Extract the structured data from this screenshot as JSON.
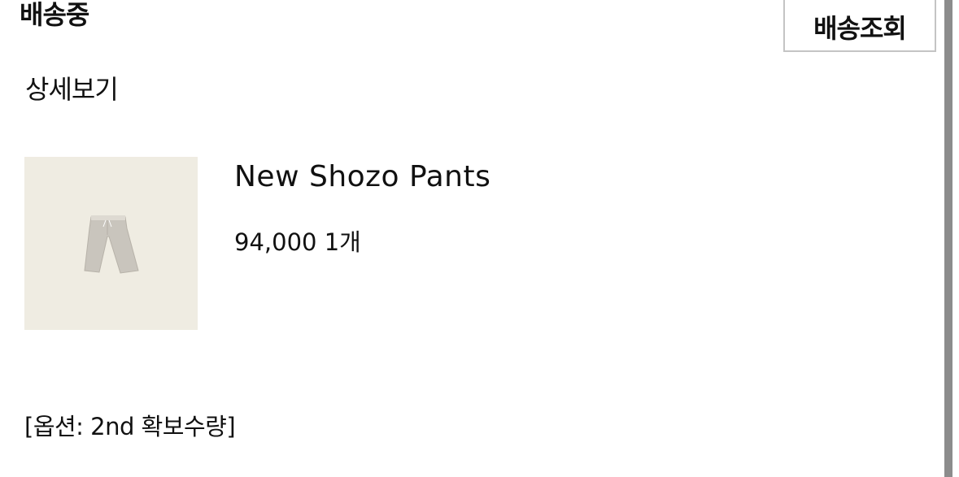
{
  "order": {
    "status": "배송중",
    "track_label": "배송조회",
    "detail_label": "상세보기"
  },
  "item": {
    "name": "New Shozo Pants",
    "price_qty": "94,000 1개",
    "option": "[옵션: 2nd 확보수량]",
    "image": "pants-product-photo"
  }
}
